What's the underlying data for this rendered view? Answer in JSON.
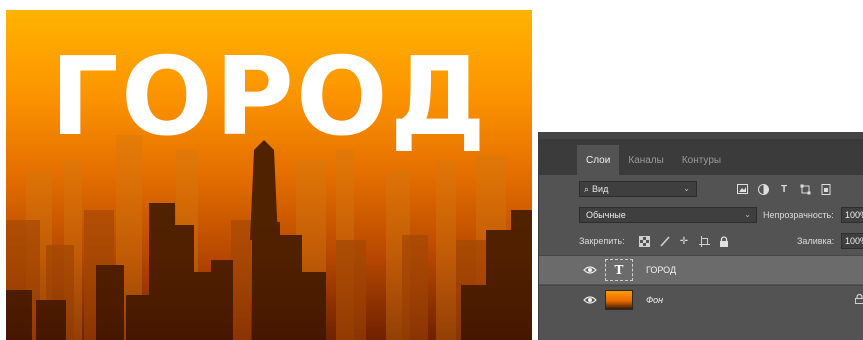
{
  "image": {
    "overlay_text": "ГОРОД"
  },
  "panel": {
    "tabs": [
      {
        "label": "Слои",
        "active": true
      },
      {
        "label": "Каналы",
        "active": false
      },
      {
        "label": "Контуры",
        "active": false
      }
    ],
    "search": {
      "value": "Вид"
    },
    "filter_icons": [
      "image-filter-icon",
      "adjustment-filter-icon",
      "type-filter-icon",
      "shape-filter-icon",
      "smart-object-filter-icon"
    ],
    "blend": {
      "mode": "Обычные",
      "opacity_label": "Непрозрачность:",
      "opacity_value": "100%"
    },
    "lock": {
      "label": "Закрепить:",
      "fill_label": "Заливка:",
      "fill_value": "100%"
    },
    "layers": [
      {
        "name": "ГОРОД",
        "thumb": "T",
        "type": "text",
        "selected": true
      },
      {
        "name": "Фон",
        "type": "background",
        "selected": false,
        "locked": true
      }
    ],
    "colors": {
      "panel_bg": "#535353",
      "selected_row": "#6b6b6b",
      "tab_strip": "#3b3b3b"
    }
  }
}
